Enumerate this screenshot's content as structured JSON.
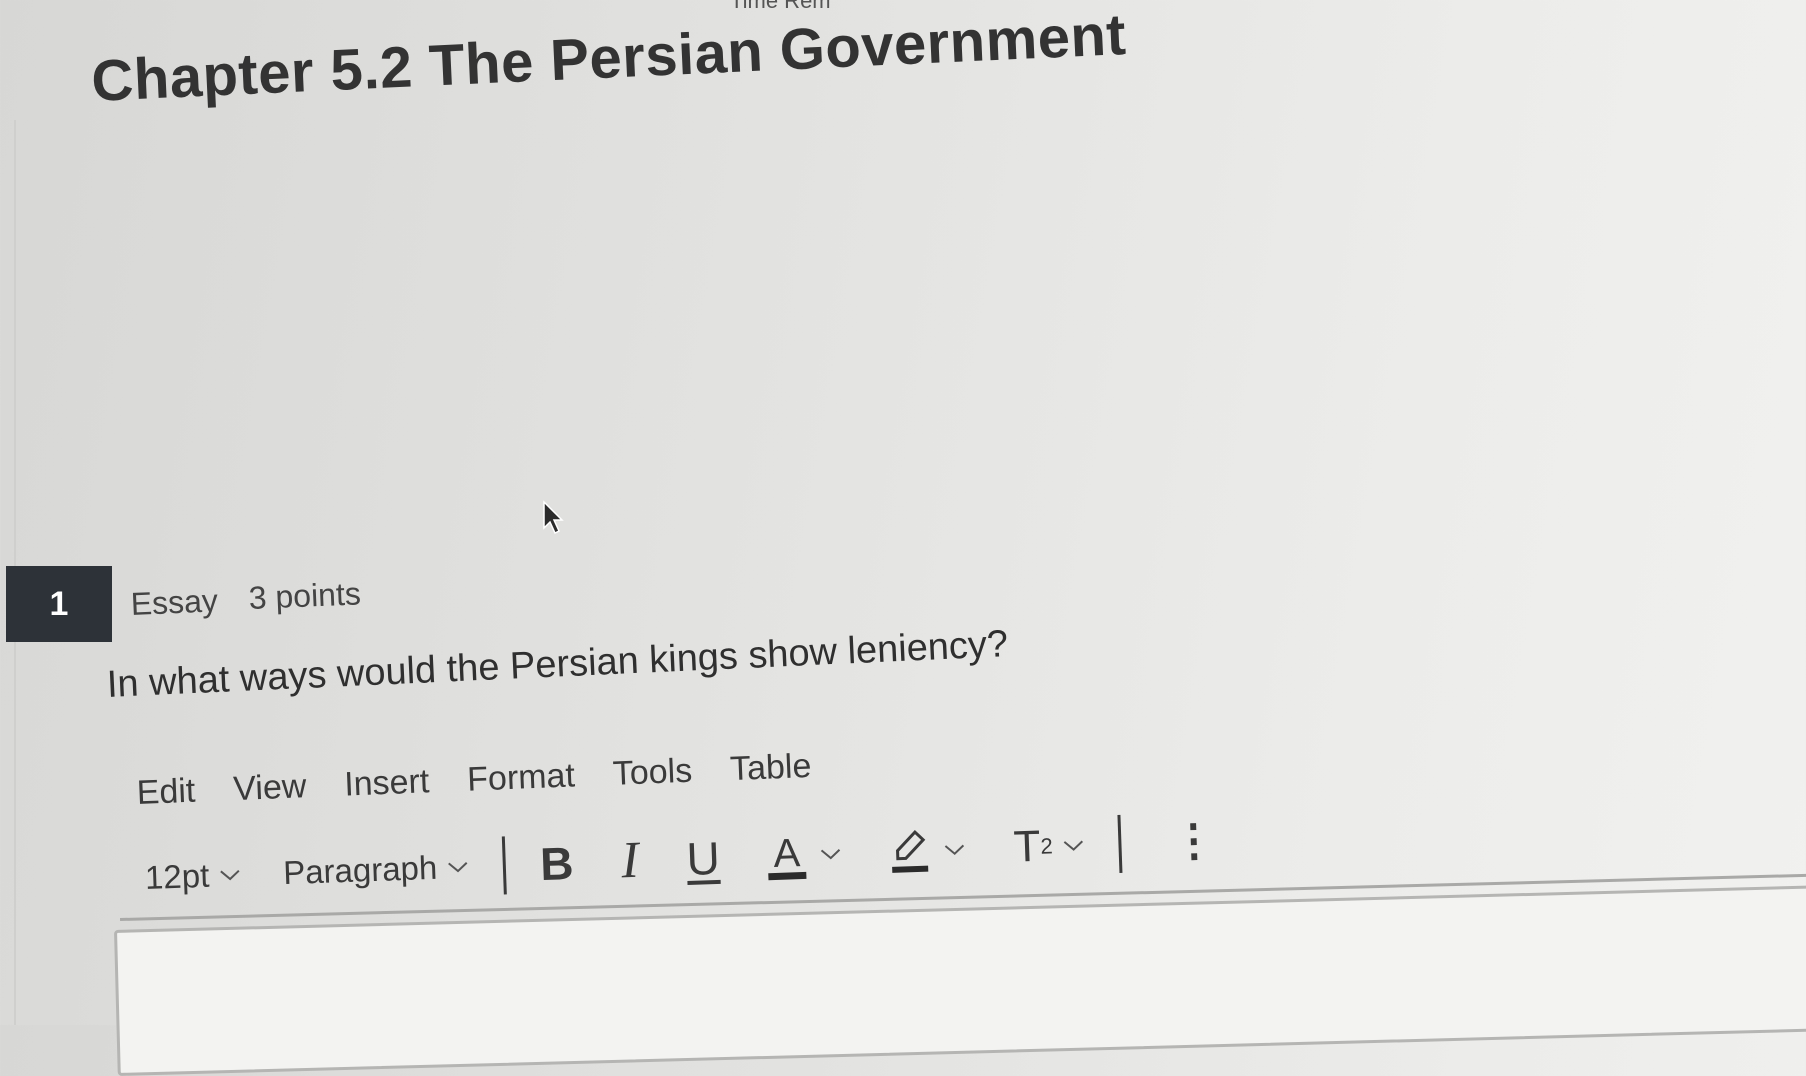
{
  "header": {
    "fragment": "Time Rem",
    "title": "Chapter 5.2 The Persian Government"
  },
  "question": {
    "number": "1",
    "type": "Essay",
    "points": "3 points",
    "prompt": "In what ways would the Persian kings show leniency?"
  },
  "editor": {
    "menu": [
      "Edit",
      "View",
      "Insert",
      "Format",
      "Tools",
      "Table"
    ],
    "font_size": "12pt",
    "block_format": "Paragraph",
    "buttons": {
      "bold": "B",
      "italic": "I",
      "underline": "U",
      "text_color": "A",
      "superscript_base": "T",
      "superscript_exp": "2",
      "more": "⋮"
    },
    "text_color_hex": "#2b2b2b",
    "highlight_color_hex": "#2b2b2b",
    "content": ""
  },
  "icons": [
    "mouse-cursor-icon",
    "chevron-down-icon",
    "highlighter-icon",
    "more-vertical-icon"
  ]
}
